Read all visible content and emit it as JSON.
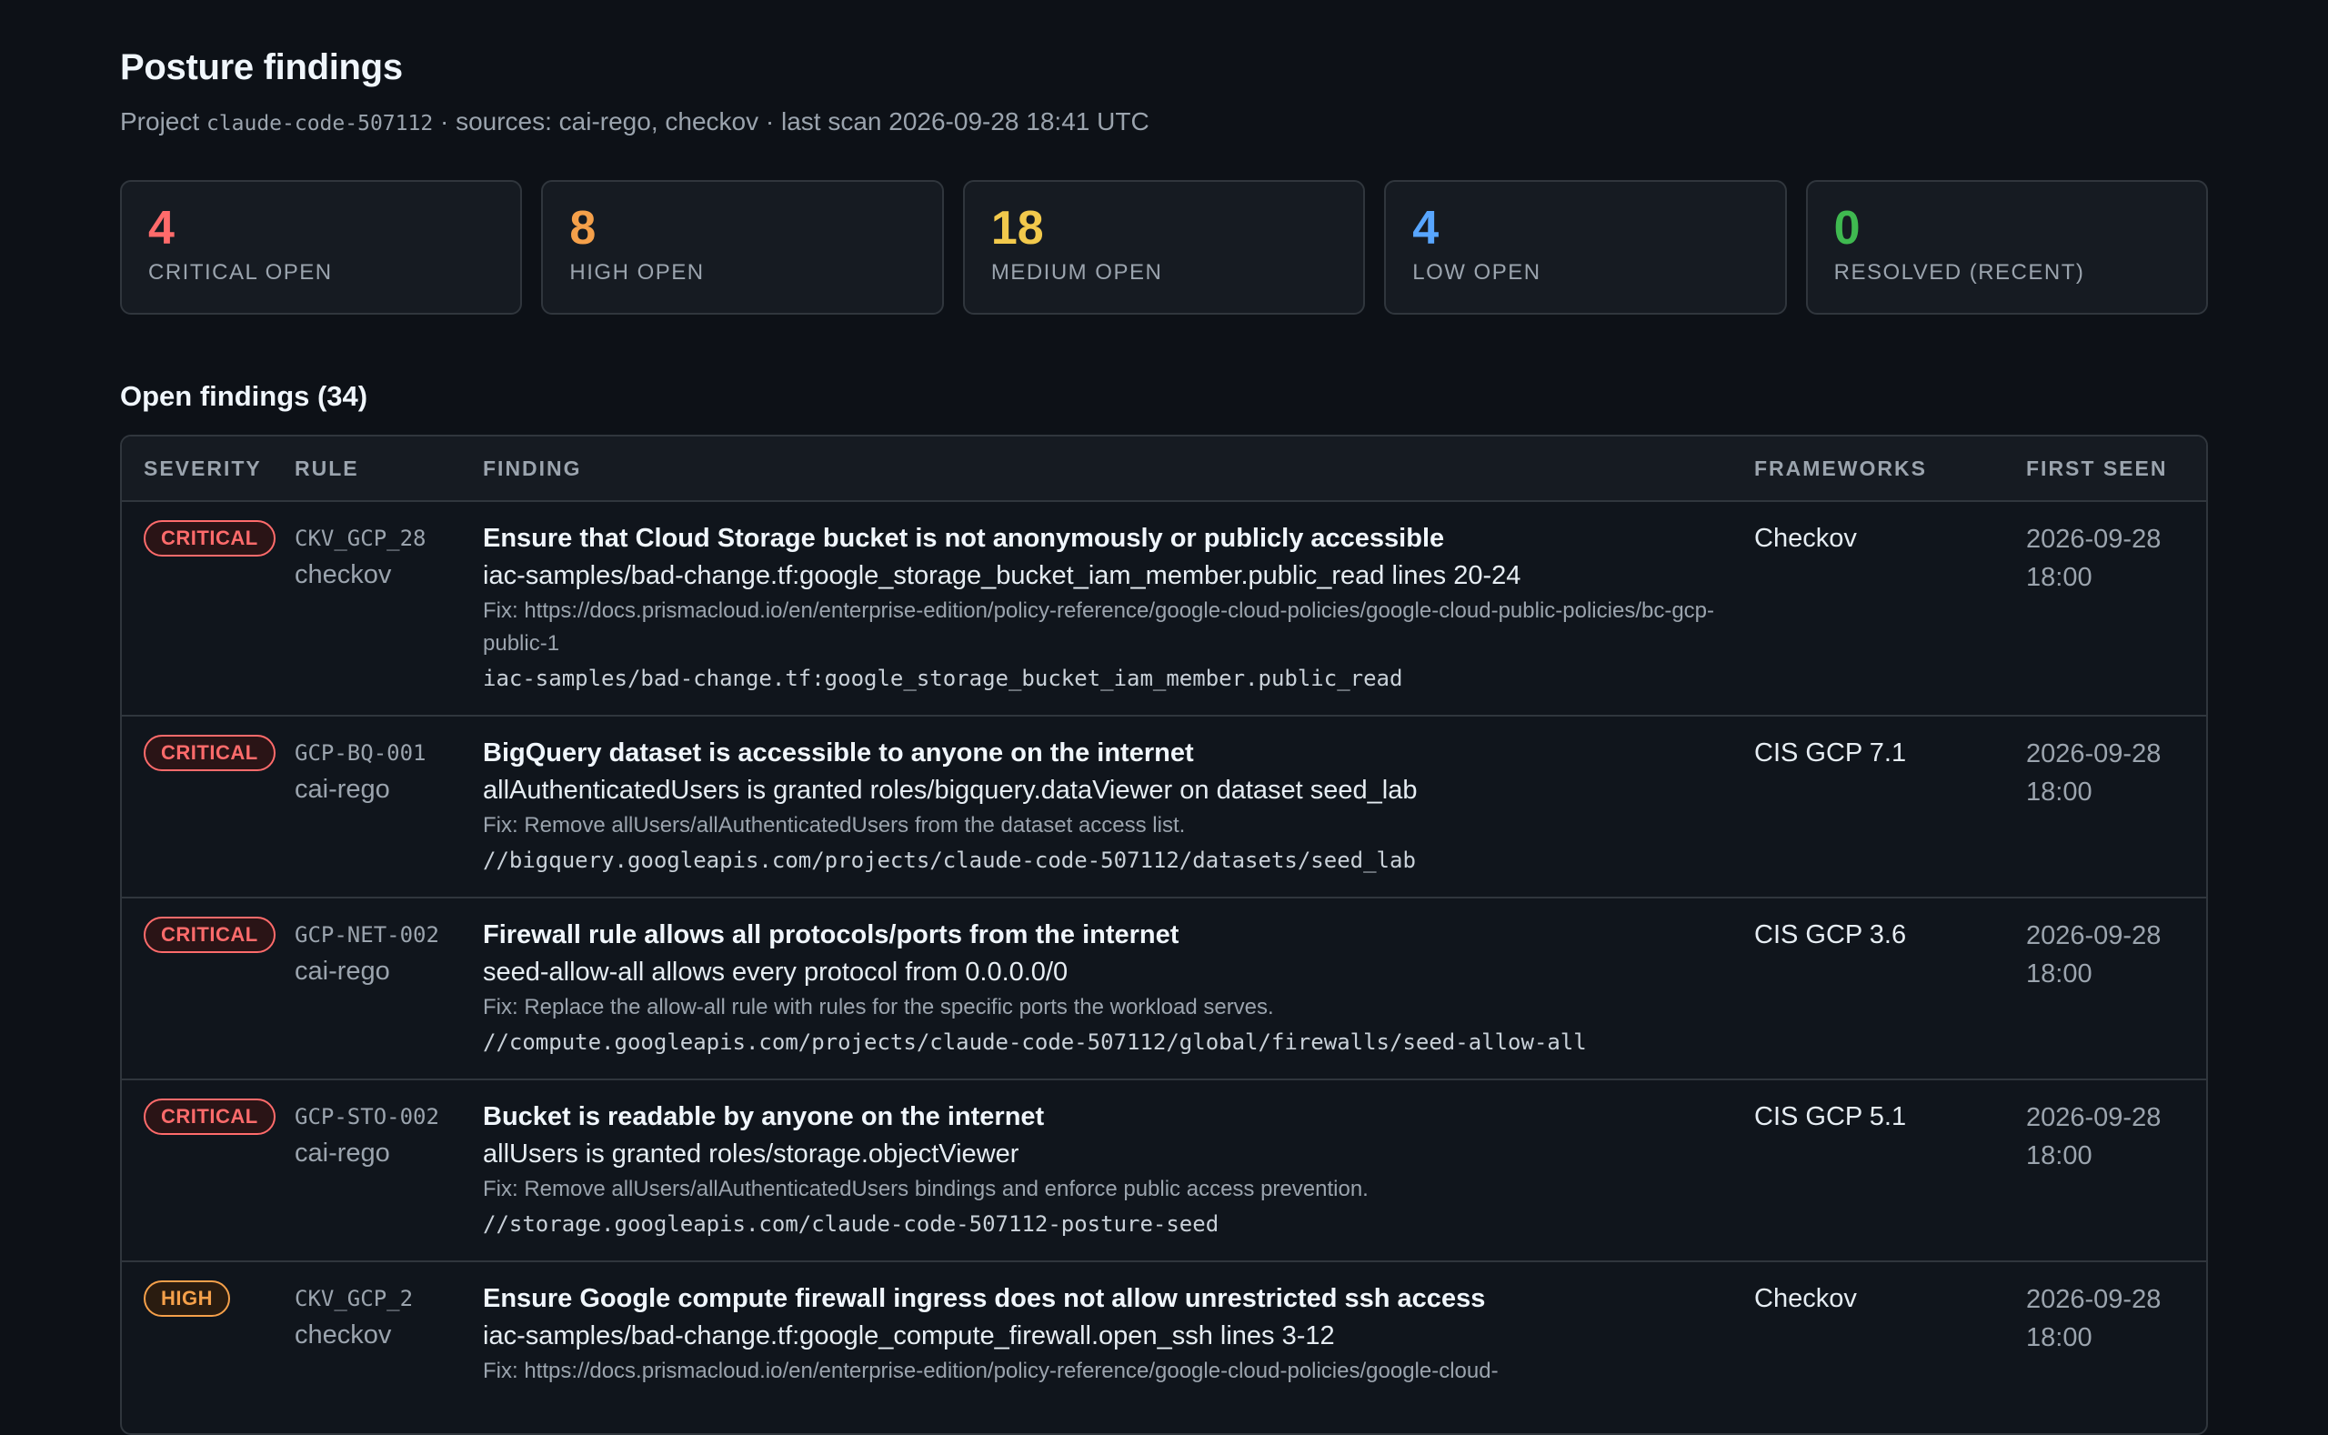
{
  "header": {
    "title": "Posture findings",
    "subtitle_prefix": "Project",
    "project_id": "claude-code-507112",
    "subtitle_suffix": "· sources: cai-rego, checkov · last scan 2026-09-28 18:41 UTC"
  },
  "summary": [
    {
      "value": "4",
      "label": "Critical open",
      "color": "#ff6b6b"
    },
    {
      "value": "8",
      "label": "High open",
      "color": "#f5a04a"
    },
    {
      "value": "18",
      "label": "Medium open",
      "color": "#f2c94c"
    },
    {
      "value": "4",
      "label": "Low open",
      "color": "#58a6ff"
    },
    {
      "value": "0",
      "label": "Resolved (recent)",
      "color": "#3fb950"
    }
  ],
  "findings": {
    "section_title": "Open findings (34)",
    "columns": {
      "severity": "Severity",
      "rule": "Rule",
      "finding": "Finding",
      "frameworks": "Frameworks",
      "first_seen": "First seen"
    },
    "rows": [
      {
        "severity": "CRITICAL",
        "severity_class": "critical",
        "rule_id": "CKV_GCP_28",
        "rule_source": "checkov",
        "title": "Ensure that Cloud Storage bucket is not anonymously or publicly accessible",
        "description": "iac-samples/bad-change.tf:google_storage_bucket_iam_member.public_read lines 20-24",
        "fix": "Fix: https://docs.prismacloud.io/en/enterprise-edition/policy-reference/google-cloud-policies/google-cloud-public-policies/bc-gcp-public-1",
        "resource": "iac-samples/bad-change.tf:google_storage_bucket_iam_member.public_read",
        "frameworks": "Checkov",
        "first_seen": "2026-09-28 18:00"
      },
      {
        "severity": "CRITICAL",
        "severity_class": "critical",
        "rule_id": "GCP-BQ-001",
        "rule_source": "cai-rego",
        "title": "BigQuery dataset is accessible to anyone on the internet",
        "description": "allAuthenticatedUsers is granted roles/bigquery.dataViewer on dataset seed_lab",
        "fix": "Fix: Remove allUsers/allAuthenticatedUsers from the dataset access list.",
        "resource": "//bigquery.googleapis.com/projects/claude-code-507112/datasets/seed_lab",
        "frameworks": "CIS GCP 7.1",
        "first_seen": "2026-09-28 18:00"
      },
      {
        "severity": "CRITICAL",
        "severity_class": "critical",
        "rule_id": "GCP-NET-002",
        "rule_source": "cai-rego",
        "title": "Firewall rule allows all protocols/ports from the internet",
        "description": "seed-allow-all allows every protocol from 0.0.0.0/0",
        "fix": "Fix: Replace the allow-all rule with rules for the specific ports the workload serves.",
        "resource": "//compute.googleapis.com/projects/claude-code-507112/global/firewalls/seed-allow-all",
        "frameworks": "CIS GCP 3.6",
        "first_seen": "2026-09-28 18:00"
      },
      {
        "severity": "CRITICAL",
        "severity_class": "critical",
        "rule_id": "GCP-STO-002",
        "rule_source": "cai-rego",
        "title": "Bucket is readable by anyone on the internet",
        "description": "allUsers is granted roles/storage.objectViewer",
        "fix": "Fix: Remove allUsers/allAuthenticatedUsers bindings and enforce public access prevention.",
        "resource": "//storage.googleapis.com/claude-code-507112-posture-seed",
        "frameworks": "CIS GCP 5.1",
        "first_seen": "2026-09-28 18:00"
      },
      {
        "severity": "HIGH",
        "severity_class": "high",
        "rule_id": "CKV_GCP_2",
        "rule_source": "checkov",
        "title": "Ensure Google compute firewall ingress does not allow unrestricted ssh access",
        "description": "iac-samples/bad-change.tf:google_compute_firewall.open_ssh lines 3-12",
        "fix": "Fix: https://docs.prismacloud.io/en/enterprise-edition/policy-reference/google-cloud-policies/google-cloud-",
        "resource": "",
        "frameworks": "Checkov",
        "first_seen": "2026-09-28 18:00"
      }
    ]
  }
}
